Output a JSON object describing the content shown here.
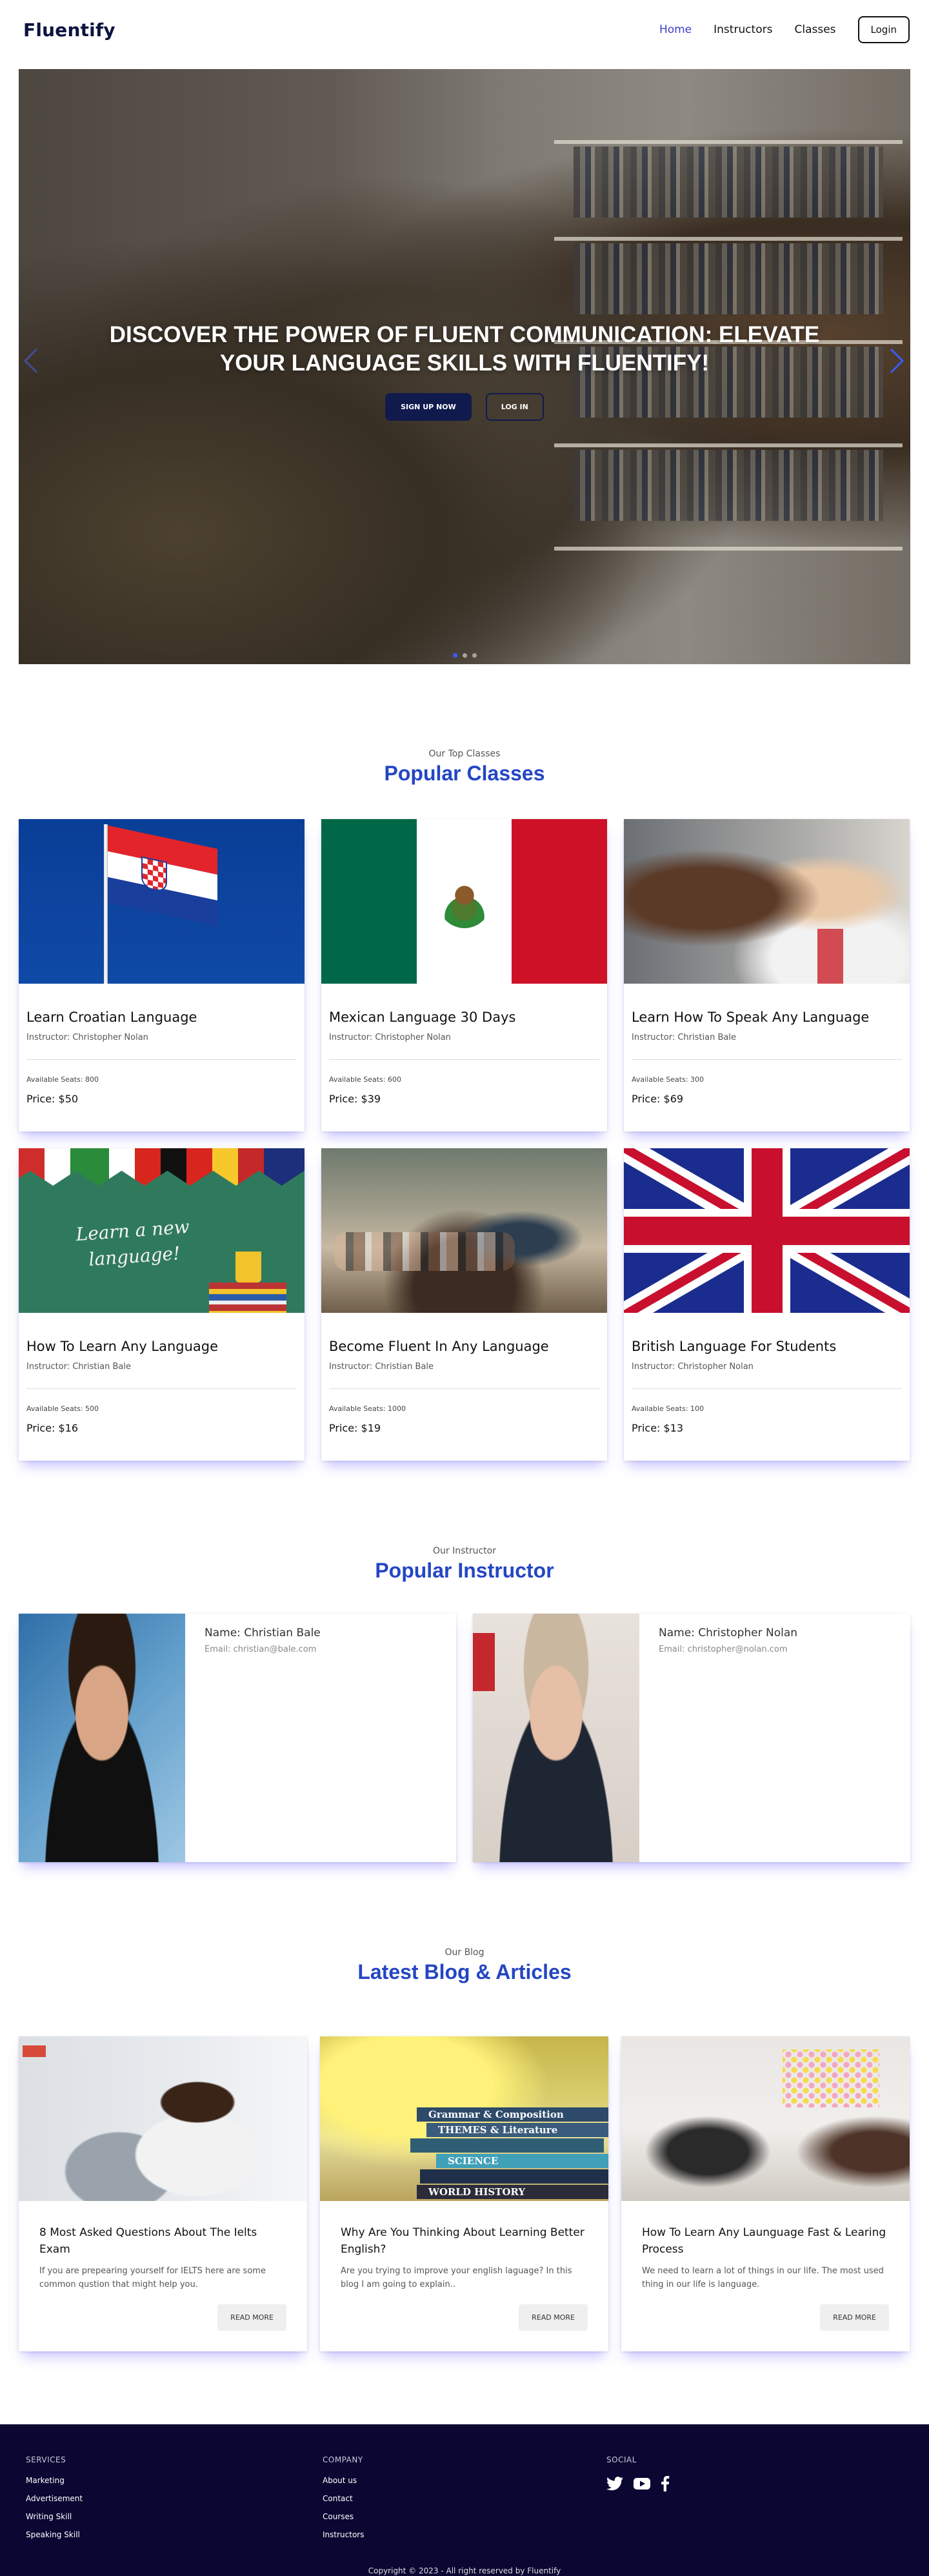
{
  "nav": {
    "brand": "Fluentify",
    "links": [
      "Home",
      "Instructors",
      "Classes"
    ],
    "login": "Login"
  },
  "hero": {
    "title": "DISCOVER THE POWER OF FLUENT COMMUNICATION: ELEVATE YOUR LANGUAGE SKILLS WITH FLUENTIFY!",
    "signup": "SIGN UP NOW",
    "login": "LOG IN",
    "prev_icon": "chevron-left-icon",
    "next_icon": "chevron-right-icon",
    "slides": 3,
    "active_slide": 1
  },
  "classes": {
    "subtitle": "Our Top Classes",
    "title": "Popular Classes",
    "items": [
      {
        "title": "Learn Croatian Language",
        "instructor": "Instructor: Christopher Nolan",
        "seats": "Available Seats: 800",
        "price": "Price: $50"
      },
      {
        "title": "Mexican Language 30 Days",
        "instructor": "Instructor: Christopher Nolan",
        "seats": "Available Seats: 600",
        "price": "Price: $39"
      },
      {
        "title": "Learn How To Speak Any Language",
        "instructor": "Instructor: Christian Bale",
        "seats": "Available Seats: 300",
        "price": "Price: $69"
      },
      {
        "title": "How To Learn Any Language",
        "instructor": "Instructor: Christian Bale",
        "seats": "Available Seats: 500",
        "price": "Price: $16",
        "image_text": [
          "Learn a new",
          "language!"
        ]
      },
      {
        "title": "Become Fluent In Any Language",
        "instructor": "Instructor: Christian Bale",
        "seats": "Available Seats: 1000",
        "price": "Price: $19"
      },
      {
        "title": "British Language For Students",
        "instructor": "Instructor: Christopher Nolan",
        "seats": "Available Seats: 100",
        "price": "Price: $13"
      }
    ]
  },
  "instructors": {
    "subtitle": "Our Instructor",
    "title": "Popular Instructor",
    "items": [
      {
        "name": "Name: Christian Bale",
        "email": "Email: christian@bale.com"
      },
      {
        "name": "Name: Christopher Nolan",
        "email": "Email: christopher@nolan.com"
      }
    ]
  },
  "blog": {
    "subtitle": "Our Blog",
    "title": "Latest Blog & Articles",
    "read_more": "READ MORE",
    "items": [
      {
        "title": "8 Most Asked Questions About The Ielts Exam",
        "excerpt": "If you are prepearing yourself for IELTS here are some common qustion that might help you."
      },
      {
        "title": "Why Are You Thinking About Learning Better English?",
        "excerpt": "Are you trying to improve your english laguage? In this blog I am going to explain..",
        "image_text": [
          "Grammar & Composition",
          "THEMES & Literature",
          "SCIENCE",
          "WORLD HISTORY"
        ]
      },
      {
        "title": "How To Learn Any Launguage Fast & Learing Process",
        "excerpt": "We need to learn a lot of things in our life. The most used thing in our life is language."
      }
    ]
  },
  "footer": {
    "services": {
      "head": "SERVICES",
      "items": [
        "Marketing",
        "Advertisement",
        "Writing Skill",
        "Speaking Skill"
      ]
    },
    "company": {
      "head": "COMPANY",
      "items": [
        "About us",
        "Contact",
        "Courses",
        "Instructors"
      ]
    },
    "social": {
      "head": "SOCIAL",
      "icons": [
        "twitter-icon",
        "youtube-icon",
        "facebook-icon"
      ]
    },
    "copyright": "Copyright © 2023 - All right reserved by Fluentify"
  },
  "colors": {
    "accent": "#2446c4",
    "nav_active": "#3b3fc7",
    "hero_button": "#111a4d",
    "footer_bg": "#0a0733",
    "card_shadow": "#5c54ff"
  }
}
